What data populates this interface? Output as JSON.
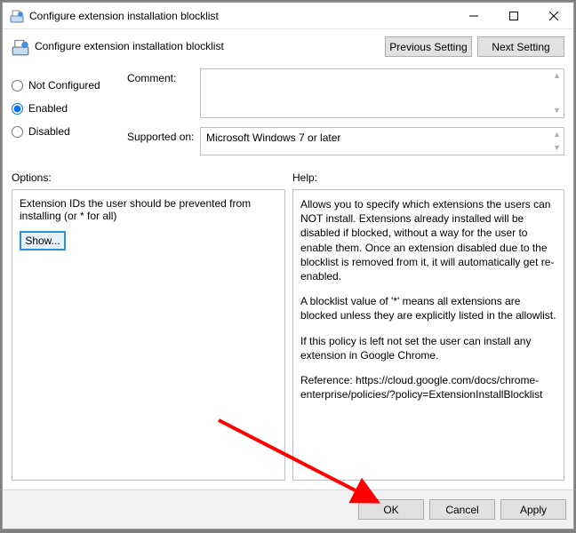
{
  "titlebar": {
    "title": "Configure extension installation blocklist"
  },
  "header": {
    "title": "Configure extension installation blocklist",
    "prev_label": "Previous Setting",
    "next_label": "Next Setting"
  },
  "radios": {
    "not_configured": "Not Configured",
    "enabled": "Enabled",
    "disabled": "Disabled",
    "selected": "enabled"
  },
  "comment": {
    "label": "Comment:",
    "value": ""
  },
  "supported": {
    "label": "Supported on:",
    "value": "Microsoft Windows 7 or later"
  },
  "options": {
    "label": "Options:",
    "text": "Extension IDs the user should be prevented from installing (or * for all)",
    "show_label": "Show..."
  },
  "help": {
    "label": "Help:",
    "p1": "Allows you to specify which extensions the users can NOT install. Extensions already installed will be disabled if blocked, without a way for the user to enable them. Once an extension disabled due to the blocklist is removed from it, it will automatically get re-enabled.",
    "p2": "A blocklist value of '*' means all extensions are blocked unless they are explicitly listed in the allowlist.",
    "p3": "If this policy is left not set the user can install any extension in Google Chrome.",
    "p4": "Reference: https://cloud.google.com/docs/chrome-enterprise/policies/?policy=ExtensionInstallBlocklist"
  },
  "buttons": {
    "ok": "OK",
    "cancel": "Cancel",
    "apply": "Apply"
  }
}
